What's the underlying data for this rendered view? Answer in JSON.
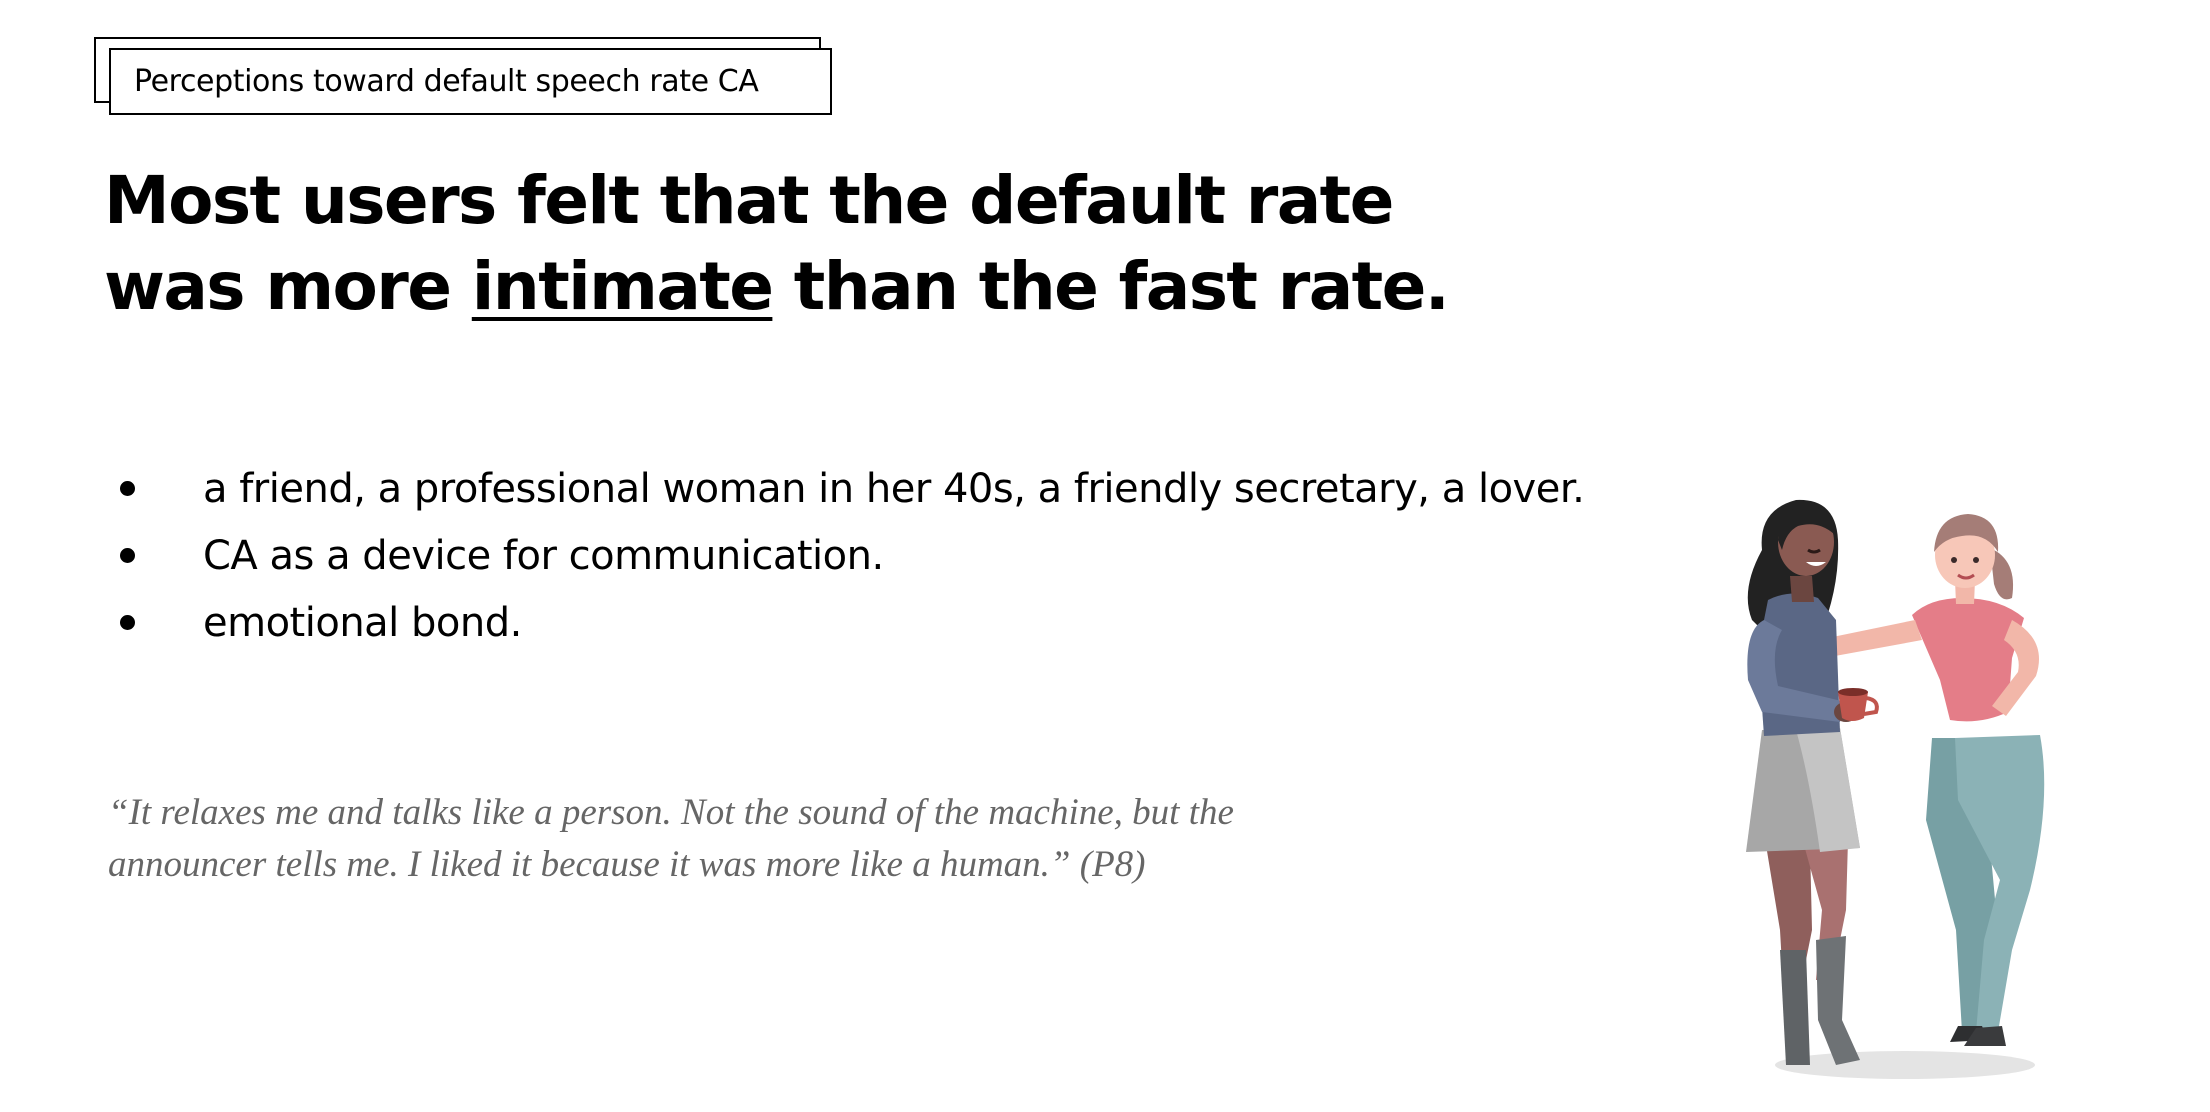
{
  "tag": {
    "label": "Perceptions toward default speech rate CA"
  },
  "headline": {
    "line1": "Most users felt that the default rate",
    "line2_before": "was more ",
    "line2_underlined": "intimate",
    "line2_after": " than the fast rate."
  },
  "bullets": [
    "a friend, a professional woman in her 40s, a friendly secretary, a lover.",
    "CA as a device for communication.",
    "emotional bond."
  ],
  "quote": {
    "line1": "“It relaxes me and talks like a person. Not the sound of the machine, but the",
    "line2": "announcer tells me. I liked it because it was more like a human.” (P8)"
  },
  "illustration": {
    "icon": "two-women-friends-illustration"
  },
  "colors": {
    "quote": "#666666",
    "shirt_pink": "#e47d88",
    "pants_teal": "#8bb2b6",
    "sweater_slate": "#5a6785",
    "skirt_gray": "#a7a7a7",
    "boots_gray": "#5f6366"
  }
}
